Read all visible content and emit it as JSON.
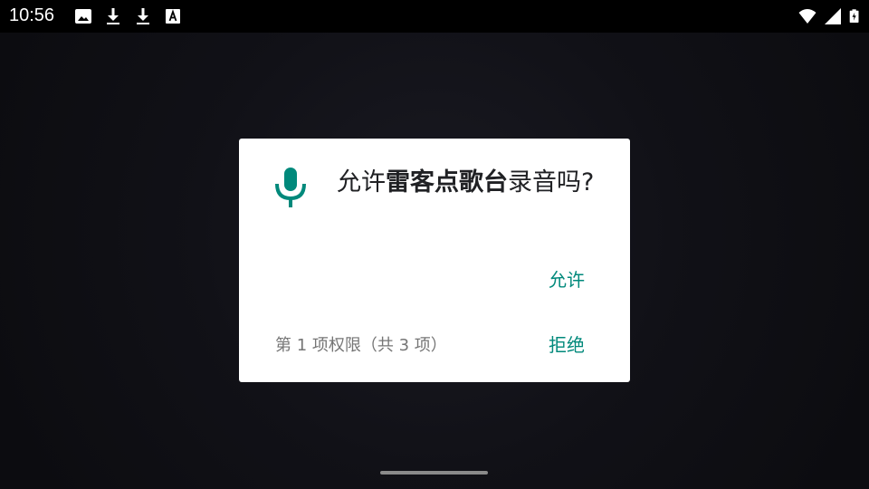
{
  "status_bar": {
    "time": "10:56",
    "left_icons": [
      "image-icon",
      "download-icon",
      "download-icon",
      "text-icon"
    ],
    "right_icons": [
      "wifi-icon",
      "signal-icon",
      "battery-icon"
    ]
  },
  "dialog": {
    "title_prefix": "允许",
    "app_name": "雷客点歌台",
    "title_suffix": "录音吗?",
    "allow_label": "允许",
    "deny_label": "拒绝",
    "counter_text": "第 1 项权限（共 3 项）",
    "icon": "microphone-icon",
    "accent_color": "#00897b"
  }
}
